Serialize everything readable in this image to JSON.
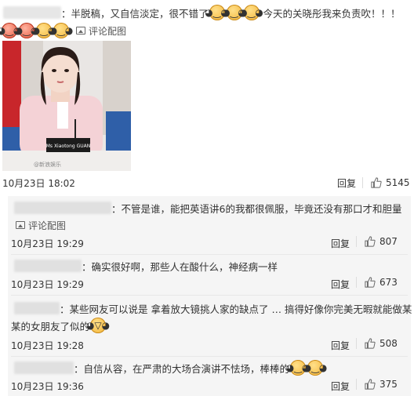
{
  "main_comment": {
    "text": "：半脱稿，又自信淡定，很不错了",
    "text2": "今天的关晓彤我来负责吹！！！",
    "pic_link": "评论配图",
    "photo_nameplate": "Ms Xiaotong GUAN",
    "photo_watermark": "@新浪娱乐",
    "date": "10月23日 18:02",
    "reply": "回复",
    "likes": "5145"
  },
  "replies": [
    {
      "text": "：不管是谁，能把英语讲6的我都很佩服，毕竟还没有那口才和胆量",
      "pic_link": "评论配图",
      "date": "10月23日 19:29",
      "reply": "回复",
      "likes": "807"
    },
    {
      "text": "：确实很好啊，那些人在酸什么，神经病一样",
      "date": "10月23日 19:29",
      "reply": "回复",
      "likes": "673"
    },
    {
      "text": "：某些网友可以说是 拿着放大镜挑人家的缺点了 … 搞得好像你完美无暇就能做某",
      "text2": "某的女朋友了似的",
      "date": "10月23日 19:28",
      "reply": "回复",
      "likes": "508"
    },
    {
      "text": "：自信从容，在严肃的大场合演讲不怯场，棒棒的",
      "date": "10月23日 19:36",
      "reply": "回复",
      "likes": "375"
    }
  ],
  "icons": {
    "emoji_face": "emoji-face-icon",
    "picture": "picture-icon",
    "thumb": "thumb-up-icon"
  }
}
